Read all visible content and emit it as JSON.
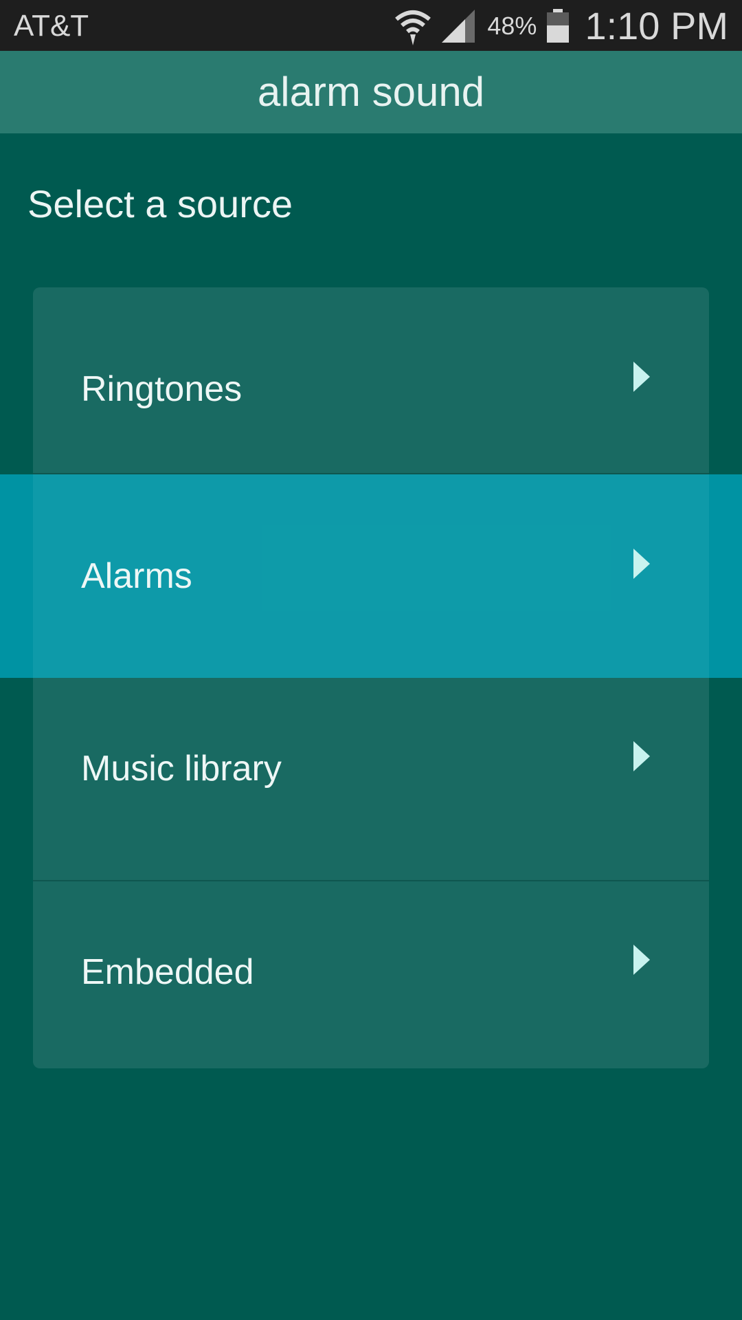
{
  "status_bar": {
    "carrier": "AT&T",
    "battery_percent": "48%",
    "time": "1:10 PM",
    "icons": [
      "wifi-icon",
      "signal-icon",
      "battery-icon"
    ]
  },
  "header": {
    "title": "alarm sound"
  },
  "main": {
    "heading": "Select a source",
    "items": [
      {
        "label": "Ringtones",
        "selected": false
      },
      {
        "label": "Alarms",
        "selected": true
      },
      {
        "label": "Music library",
        "selected": false
      },
      {
        "label": "Embedded",
        "selected": false
      }
    ]
  },
  "colors": {
    "status_bar_bg": "#1e1e1e",
    "title_bar_bg": "#2a7b70",
    "page_bg": "#005a50",
    "list_bg": "#196a62",
    "selected_bg": "#0093a3",
    "chevron": "#c8f3ef"
  }
}
